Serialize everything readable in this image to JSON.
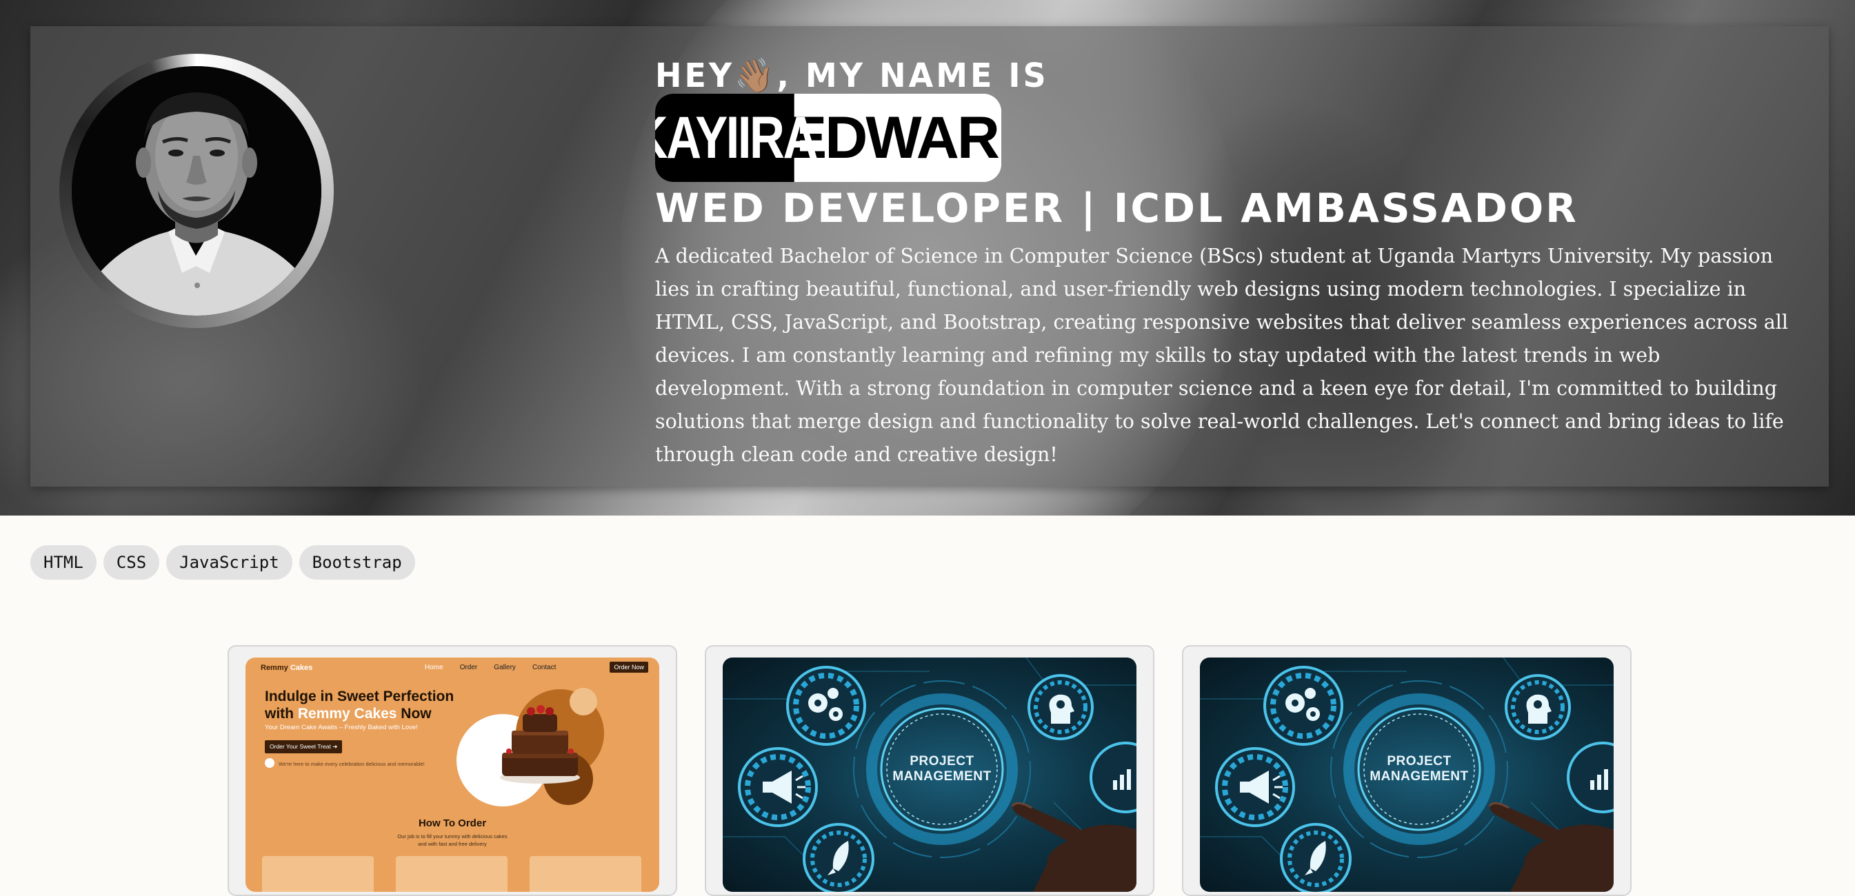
{
  "hero": {
    "greeting": "HEY👋🏽, MY NAME IS",
    "first_name": "KAYIIRA",
    "last_name": "EDWARD",
    "role": "WED DEVELOPER | ICDL AMBASSADOR",
    "bio": "A dedicated Bachelor of Science in Computer Science (BScs) student at Uganda Martyrs University. My passion lies in crafting beautiful, functional, and user-friendly web designs using modern technologies. I specialize in HTML, CSS, JavaScript, and Bootstrap, creating responsive websites that deliver seamless experiences across all devices. I am constantly learning and refining my skills to stay updated with the latest trends in web development. With a strong foundation in computer science and a keen eye for detail, I'm committed to building solutions that merge design and functionality to solve real-world challenges. Let's connect and bring ideas to life through clean code and creative design!"
  },
  "skills": [
    "HTML",
    "CSS",
    "JavaScript",
    "Bootstrap"
  ],
  "projects": [
    {
      "kind": "website-preview",
      "brand_prefix": "Remmy",
      "brand_suffix": "Cakes",
      "nav_links": [
        "Home",
        "Order",
        "Gallery",
        "Contact"
      ],
      "nav_button": "Order Now",
      "headline_pre": "Indulge in Sweet Perfection with",
      "headline_highlight": "Remmy Cakes",
      "headline_post": "Now",
      "subtitle": "Your Dream Cake Awaits – Freshly Baked with Love!",
      "cta": "Order Your Sweet Treat ➜",
      "quote": "We're here to make every celebration delicious and memorable!",
      "section_title": "How To Order",
      "section_sub_1": "Our job is to fill your tummy with delicious cakes",
      "section_sub_2": "and with fast and free delivery"
    },
    {
      "kind": "image",
      "label_1": "PROJECT",
      "label_2": "MANAGEMENT"
    },
    {
      "kind": "image",
      "label_1": "PROJECT",
      "label_2": "MANAGEMENT"
    }
  ],
  "colors": {
    "page_bg": "#fcfbf8",
    "tag_bg": "#e2e2e2",
    "cakes_bg": "#eaa15b",
    "pm_bg": "#0e3546",
    "pm_accent": "#39b6e0"
  },
  "icons": [
    "wave-hand-emoji",
    "gears-icon",
    "head-gear-icon",
    "megaphone-icon",
    "rocket-icon",
    "chart-icon",
    "pointing-hand-icon"
  ]
}
